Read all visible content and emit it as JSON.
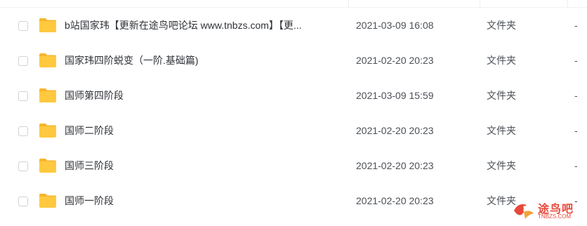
{
  "columns": {
    "size_placeholder": "-"
  },
  "rows": [
    {
      "name": "b站国家玮【更新在途鸟吧论坛 www.tnbzs.com】【更...",
      "modified": "2021-03-09 16:08",
      "type": "文件夹",
      "size": "-"
    },
    {
      "name": "国家玮四阶蜕变（一阶.基础篇)",
      "modified": "2021-02-20 20:23",
      "type": "文件夹",
      "size": "-"
    },
    {
      "name": "国师第四阶段",
      "modified": "2021-03-09 15:59",
      "type": "文件夹",
      "size": "-"
    },
    {
      "name": "国师二阶段",
      "modified": "2021-02-20 20:23",
      "type": "文件夹",
      "size": "-"
    },
    {
      "name": "国师三阶段",
      "modified": "2021-02-20 20:23",
      "type": "文件夹",
      "size": "-"
    },
    {
      "name": "国师一阶段",
      "modified": "2021-02-20 20:23",
      "type": "文件夹",
      "size": "-"
    }
  ],
  "icons": {
    "row_icon": "folder-icon",
    "folder_color": "#ffc93f",
    "folder_tab_color": "#f7b52c"
  },
  "watermark": {
    "text": "途鸟吧",
    "subtext": "TNBZS.COM",
    "color": "#e8483a"
  }
}
